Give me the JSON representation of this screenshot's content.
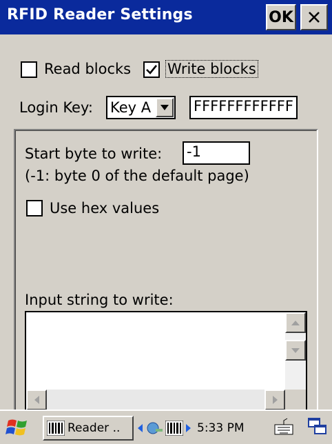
{
  "window": {
    "title": "RFID Reader Settings",
    "ok_label": "OK",
    "close_icon": "close-icon"
  },
  "options": {
    "read_blocks_label": "Read blocks",
    "read_blocks_checked": false,
    "write_blocks_label": "Write blocks",
    "write_blocks_checked": true
  },
  "login": {
    "label": "Login Key:",
    "key_type_selected": "Key A",
    "key_value": "FFFFFFFFFFFF"
  },
  "write_panel": {
    "start_byte_label": "Start byte to write:",
    "start_byte_value": "-1",
    "hint": "(-1: byte 0 of the default page)",
    "use_hex_label": "Use hex values",
    "use_hex_checked": false,
    "input_label": "Input string to write:",
    "input_value": ""
  },
  "taskbar": {
    "start_icon": "windows-flag-icon",
    "task_label": "Reader ..",
    "time": "5:33 PM",
    "keyboard_icon": "keyboard-icon",
    "desktop_icon": "switch-windows-icon"
  },
  "colors": {
    "titlebar": "#0a2a9c",
    "chrome": "#d4d0c8"
  }
}
